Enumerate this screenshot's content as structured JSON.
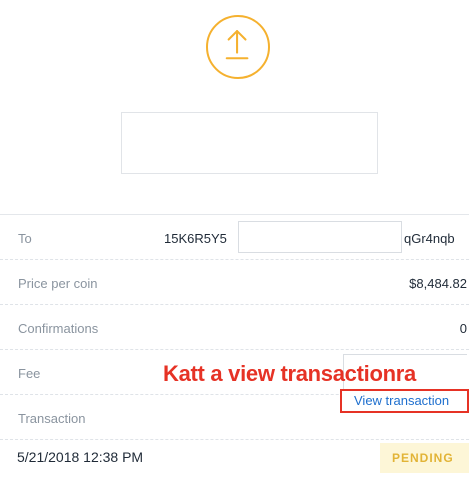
{
  "icon": "upload-arrow-icon",
  "accent_color": "#f5b12f",
  "details": {
    "to": {
      "label": "To",
      "address_start": "15K6R5Y5",
      "address_end": "qGr4nqb"
    },
    "price": {
      "label": "Price per coin",
      "value": "$8,484.82"
    },
    "confirmations": {
      "label": "Confirmations",
      "value": "0"
    },
    "fee": {
      "label": "Fee"
    },
    "transaction": {
      "label": "Transaction",
      "link": "View transaction"
    }
  },
  "annotation": "Katt a view transactionra",
  "annotation_color": "#e63225",
  "footer": {
    "date": "5/21/2018 12:38 PM",
    "status": "PENDING"
  }
}
